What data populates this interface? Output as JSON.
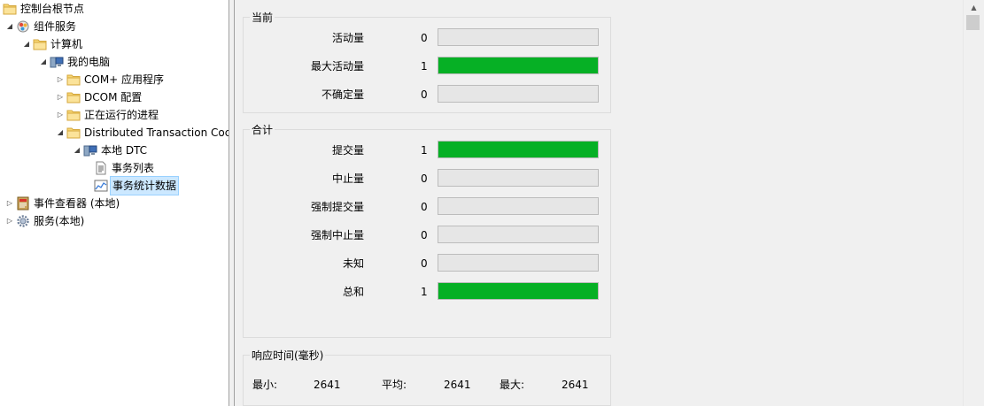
{
  "tree": {
    "nodes": [
      {
        "label": "控制台根节点",
        "icon": "folder-icon",
        "toggle": ""
      },
      {
        "label": "组件服务",
        "icon": "component-services-icon",
        "toggle": "◢"
      },
      {
        "label": "计算机",
        "icon": "folder-icon",
        "toggle": "◢"
      },
      {
        "label": "我的电脑",
        "icon": "computer-icon",
        "toggle": "◢"
      },
      {
        "label": "COM+ 应用程序",
        "icon": "folder-icon",
        "toggle": "▷"
      },
      {
        "label": "DCOM 配置",
        "icon": "folder-icon",
        "toggle": "▷"
      },
      {
        "label": "正在运行的进程",
        "icon": "folder-icon",
        "toggle": "▷"
      },
      {
        "label": "Distributed Transaction Coc",
        "icon": "folder-icon",
        "toggle": "◢"
      },
      {
        "label": "本地 DTC",
        "icon": "computer-icon",
        "toggle": "◢"
      },
      {
        "label": "事务列表",
        "icon": "list-icon",
        "toggle": ""
      },
      {
        "label": "事务统计数据",
        "icon": "chart-icon",
        "toggle": ""
      },
      {
        "label": "事件查看器 (本地)",
        "icon": "event-viewer-icon",
        "toggle": "▷"
      },
      {
        "label": "服务(本地)",
        "icon": "gear-icon",
        "toggle": "▷"
      }
    ]
  },
  "current": {
    "title": "当前",
    "rows": [
      {
        "label": "活动量",
        "value": "0",
        "fill": 0
      },
      {
        "label": "最大活动量",
        "value": "1",
        "fill": 1
      },
      {
        "label": "不确定量",
        "value": "0",
        "fill": 0
      }
    ]
  },
  "total": {
    "title": "合计",
    "rows": [
      {
        "label": "提交量",
        "value": "1",
        "fill": 1
      },
      {
        "label": "中止量",
        "value": "0",
        "fill": 0
      },
      {
        "label": "强制提交量",
        "value": "0",
        "fill": 0
      },
      {
        "label": "强制中止量",
        "value": "0",
        "fill": 0
      },
      {
        "label": "未知",
        "value": "0",
        "fill": 0
      },
      {
        "label": "总和",
        "value": "1",
        "fill": 1
      }
    ]
  },
  "response": {
    "title": "响应时间(毫秒)",
    "min_label": "最小:",
    "min_value": "2641",
    "avg_label": "平均:",
    "avg_value": "2641",
    "max_label": "最大:",
    "max_value": "2641"
  },
  "colors": {
    "bar_fill": "#06b025",
    "bar_empty": "#e6e6e6",
    "selection": "#cce8ff"
  }
}
